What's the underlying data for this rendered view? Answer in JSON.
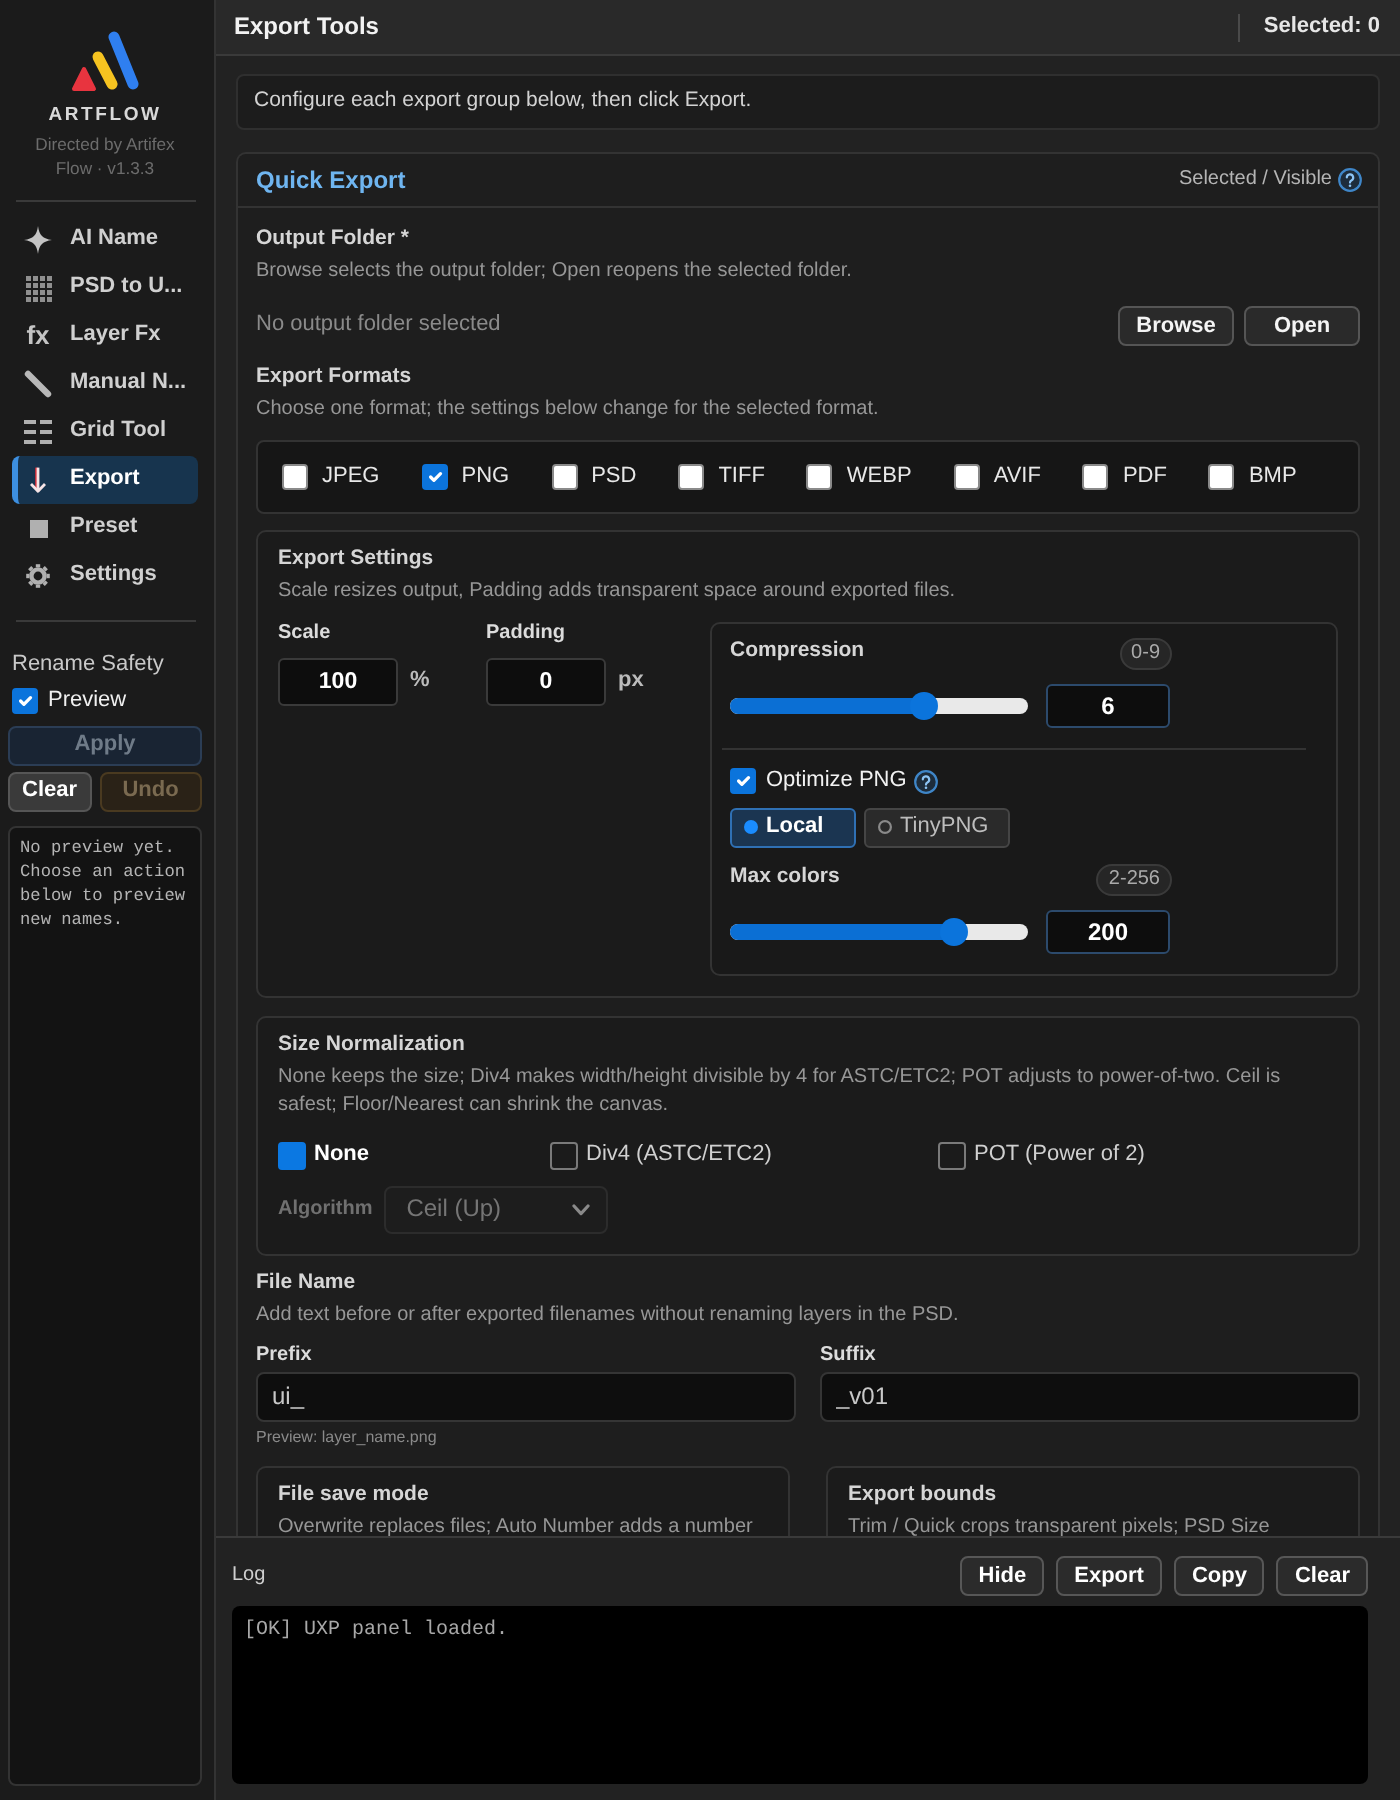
{
  "sidebar": {
    "brand": {
      "name": "ARTFLOW",
      "tagline": "Directed by Artifex Flow · v1.3.3"
    },
    "nav": [
      {
        "label": "AI Name",
        "selected": false
      },
      {
        "label": "PSD to U...",
        "selected": false
      },
      {
        "label": "Layer Fx",
        "icon_text": "fx",
        "selected": false
      },
      {
        "label": "Manual N...",
        "selected": false
      },
      {
        "label": "Grid Tool",
        "selected": false
      },
      {
        "label": "Export",
        "selected": true
      },
      {
        "label": "Preset",
        "selected": false
      },
      {
        "label": "Settings",
        "selected": false
      }
    ],
    "rename_safety": {
      "title": "Rename Safety",
      "preview": {
        "label": "Preview",
        "checked": true
      },
      "buttons": [
        {
          "label": "Apply",
          "kind": "primary",
          "disabled": true
        },
        {
          "label": "Clear",
          "kind": "secondary",
          "disabled": false
        },
        {
          "label": "Undo",
          "kind": "warning",
          "disabled": true
        }
      ],
      "output": "No preview yet. Choose an action below to preview new names."
    }
  },
  "header": {
    "title": "Export Tools",
    "selection": "Selected: 0"
  },
  "info": "Configure each export group below, then click Export.",
  "quick_export": {
    "title": "Quick Export",
    "scope": "Selected / Visible",
    "output_folder": {
      "label": "Output Folder *",
      "hint": "Browse selects the output folder; Open reopens the selected folder.",
      "status": "No output folder selected",
      "buttons": [
        "Browse",
        "Open"
      ]
    },
    "formats": {
      "label": "Export Formats",
      "hint": "Choose one format; the settings below change for the selected format.",
      "options": [
        {
          "label": "JPEG",
          "checked": false
        },
        {
          "label": "PNG",
          "checked": true
        },
        {
          "label": "PSD",
          "checked": false
        },
        {
          "label": "TIFF",
          "checked": false
        },
        {
          "label": "WEBP",
          "checked": false
        },
        {
          "label": "AVIF",
          "checked": false
        },
        {
          "label": "PDF",
          "checked": false
        },
        {
          "label": "BMP",
          "checked": false
        }
      ]
    },
    "export_settings": {
      "title": "Export Settings",
      "hint": "Scale resizes output, Padding adds transparent space around exported files.",
      "scale": {
        "label": "Scale",
        "value": "100",
        "unit": "%"
      },
      "padding": {
        "label": "Padding",
        "value": "0",
        "unit": "px"
      },
      "compression": {
        "label": "Compression",
        "range": "0-9",
        "level": 0.667,
        "value": "6"
      },
      "optimize": {
        "label": "Optimize PNG",
        "checked": true
      },
      "optimizer": [
        {
          "label": "Local",
          "selected": true
        },
        {
          "label": "TinyPNG",
          "selected": false
        }
      ],
      "max_colors": {
        "label": "Max colors",
        "range": "2-256",
        "level": 0.78,
        "value": "200"
      }
    },
    "size_normalization": {
      "title": "Size Normalization",
      "hint": "None keeps the size; Div4 makes width/height divisible by 4 for ASTC/ETC2; POT adjusts to power-of-two. Ceil is safest; Floor/Nearest can shrink the canvas.",
      "options": [
        {
          "label": "None",
          "selected": true
        },
        {
          "label": "Div4 (ASTC/ETC2)",
          "selected": false
        },
        {
          "label": "POT (Power of 2)",
          "selected": false
        }
      ],
      "algorithm": {
        "label": "Algorithm",
        "value": "Ceil (Up)",
        "disabled": true
      }
    },
    "file_name": {
      "label": "File Name",
      "hint": "Add text before or after exported filenames without renaming layers in the PSD.",
      "prefix": {
        "label": "Prefix",
        "value": "ui_"
      },
      "suffix": {
        "label": "Suffix",
        "value": "_v01"
      },
      "preview": "Preview: layer_name.png"
    },
    "save_mode": {
      "title": "File save mode",
      "hint": "Overwrite replaces files; Auto Number adds a number"
    },
    "export_bounds": {
      "title": "Export bounds",
      "hint": "Trim / Quick crops transparent pixels; PSD Size"
    }
  },
  "log": {
    "label": "Log",
    "buttons": [
      "Hide",
      "Export",
      "Copy",
      "Clear"
    ],
    "output": "[OK] UXP panel loaded."
  }
}
